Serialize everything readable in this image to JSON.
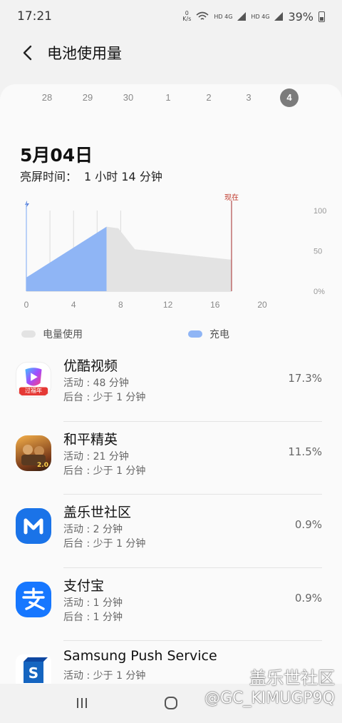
{
  "status_bar": {
    "time": "17:21",
    "net_speed_top": "0",
    "net_speed_unit": "K/s",
    "sim1": "HD 4G",
    "sim2": "HD 4G",
    "battery": "39%"
  },
  "header": {
    "title": "电池使用量",
    "back_icon": "back-arrow-icon"
  },
  "date_strip": {
    "dates": [
      "28",
      "29",
      "30",
      "1",
      "2",
      "3",
      "4"
    ],
    "selected": "4"
  },
  "day": {
    "date": "5月04日",
    "screen_on_label": "亮屏时间：",
    "screen_on_value": "1 小时 14 分钟"
  },
  "chart_data": {
    "type": "area",
    "x_ticks": [
      "0",
      "4",
      "8",
      "12",
      "16",
      "20"
    ],
    "y_ticks": [
      "100",
      "50",
      "0%"
    ],
    "xlim": [
      0,
      20
    ],
    "ylim": [
      0,
      100
    ],
    "now_label": "现在",
    "now_x": 17.4,
    "series": [
      {
        "name": "充电",
        "color": "#8fb5f5",
        "points": [
          [
            0,
            17
          ],
          [
            6.8,
            80
          ]
        ]
      },
      {
        "name": "电量使用",
        "color": "#e3e3e3",
        "points": [
          [
            6.8,
            80
          ],
          [
            7.8,
            78
          ],
          [
            9.2,
            52
          ],
          [
            17.4,
            39
          ]
        ]
      }
    ]
  },
  "legend": {
    "usage_label": "电量使用",
    "usage_color": "#e3e3e3",
    "charge_label": "充电",
    "charge_color": "#8fb5f5"
  },
  "apps": [
    {
      "name": "优酷视频",
      "active": "活动 : 48 分钟",
      "background": "后台 : 少于 1 分钟",
      "percent": "17.3%",
      "icon": "youku-icon",
      "badge": "过福年"
    },
    {
      "name": "和平精英",
      "active": "活动 : 21 分钟",
      "background": "后台 : 少于 1 分钟",
      "percent": "11.5%",
      "icon": "peace-elite-icon",
      "badge": "2.0"
    },
    {
      "name": "盖乐世社区",
      "active": "活动 : 2 分钟",
      "background": "后台 : 少于 1 分钟",
      "percent": "0.9%",
      "icon": "samsung-members-icon",
      "badge": ""
    },
    {
      "name": "支付宝",
      "active": "活动 : 1 分钟",
      "background": "后台 : 1 分钟",
      "percent": "0.9%",
      "icon": "alipay-icon",
      "badge": ""
    },
    {
      "name": "Samsung Push Service",
      "active": "活动 : 少于 1 分钟",
      "background": "",
      "percent": "",
      "icon": "samsung-push-icon",
      "badge": ""
    }
  ],
  "nav": {
    "recents_icon": "recents-icon",
    "home_icon": "home-icon"
  },
  "watermark": {
    "line1": "盖乐世社区",
    "line2": "@GC_KIMUGP9Q"
  }
}
